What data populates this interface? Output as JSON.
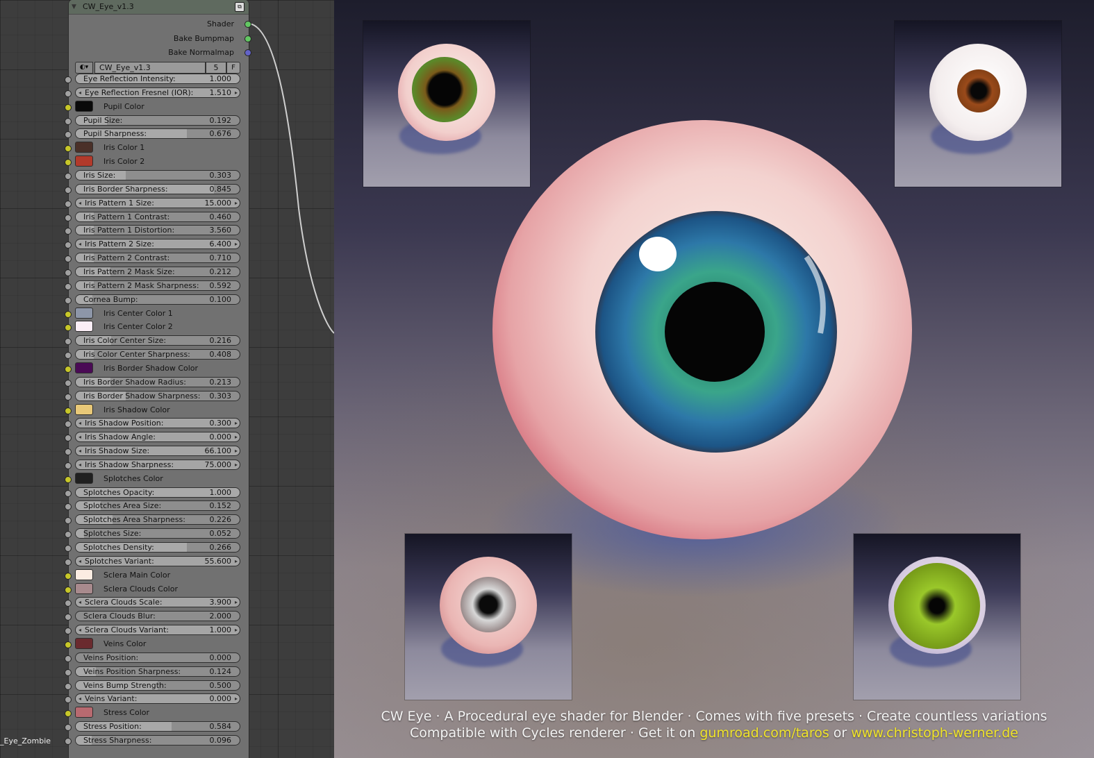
{
  "node": {
    "title": "CW_Eye_v1.3",
    "outputs": [
      "Shader",
      "Bake Bumpmap",
      "Bake Normalmap"
    ],
    "group": {
      "name": "CW_Eye_v1.3",
      "users": "5",
      "fake": "F"
    },
    "inputs": [
      {
        "kind": "slider",
        "label": "Eye Reflection Intensity:",
        "value": "1.000",
        "fill": 1.0
      },
      {
        "kind": "num",
        "label": "Eye Reflection Fresnel (IOR):",
        "value": "1.510"
      },
      {
        "kind": "color",
        "label": "Pupil Color",
        "color": "#0a0a0a"
      },
      {
        "kind": "slider",
        "label": "Pupil Size:",
        "value": "0.192",
        "fill": 0.192
      },
      {
        "kind": "slider",
        "label": "Pupil Sharpness:",
        "value": "0.676",
        "fill": 0.676
      },
      {
        "kind": "color",
        "label": "Iris Color 1",
        "color": "#4a3028"
      },
      {
        "kind": "color",
        "label": "Iris Color 2",
        "color": "#b23a2b"
      },
      {
        "kind": "slider",
        "label": "Iris Size:",
        "value": "0.303",
        "fill": 0.303
      },
      {
        "kind": "slider",
        "label": "Iris Border Sharpness:",
        "value": "0.845",
        "fill": 0.845
      },
      {
        "kind": "num",
        "label": "Iris Pattern 1 Size:",
        "value": "15.000"
      },
      {
        "kind": "slider",
        "label": "Iris Pattern 1 Contrast:",
        "value": "0.460",
        "fill": 0.11
      },
      {
        "kind": "slider",
        "label": "Iris Pattern 1 Distortion:",
        "value": "3.560",
        "fill": 0.11
      },
      {
        "kind": "num",
        "label": "Iris Pattern 2 Size:",
        "value": "6.400"
      },
      {
        "kind": "slider",
        "label": "Iris Pattern 2 Contrast:",
        "value": "0.710",
        "fill": 0.11
      },
      {
        "kind": "slider",
        "label": "Iris Pattern 2 Mask Size:",
        "value": "0.212",
        "fill": 0.212
      },
      {
        "kind": "slider",
        "label": "Iris Pattern 2 Mask Sharpness:",
        "value": "0.592",
        "fill": 0.11
      },
      {
        "kind": "slider",
        "label": "Cornea Bump:",
        "value": "0.100",
        "fill": 0.1
      },
      {
        "kind": "color",
        "label": "Iris Center Color 1",
        "color": "#8d96a8"
      },
      {
        "kind": "color",
        "label": "Iris Center Color 2",
        "color": "#fbeef6"
      },
      {
        "kind": "slider",
        "label": "Iris Color Center Size:",
        "value": "0.216",
        "fill": 0.216
      },
      {
        "kind": "slider",
        "label": "Iris Color Center Sharpness:",
        "value": "0.408",
        "fill": 0.11
      },
      {
        "kind": "color",
        "label": "Iris Border Shadow Color",
        "color": "#4a0a55"
      },
      {
        "kind": "slider",
        "label": "Iris Border Shadow Radius:",
        "value": "0.213",
        "fill": 0.213
      },
      {
        "kind": "slider",
        "label": "Iris Border Shadow Sharpness:",
        "value": "0.303",
        "fill": 0.303
      },
      {
        "kind": "color",
        "label": "Iris Shadow Color",
        "color": "#e8c878"
      },
      {
        "kind": "num",
        "label": "Iris Shadow Position:",
        "value": "0.300"
      },
      {
        "kind": "num",
        "label": "Iris Shadow Angle:",
        "value": "0.000"
      },
      {
        "kind": "num",
        "label": "Iris Shadow Size:",
        "value": "66.100"
      },
      {
        "kind": "num",
        "label": "Iris Shadow Sharpness:",
        "value": "75.000"
      },
      {
        "kind": "color",
        "label": "Splotches Color",
        "color": "#202020"
      },
      {
        "kind": "slider",
        "label": "Splotches Opacity:",
        "value": "1.000",
        "fill": 1.0
      },
      {
        "kind": "slider",
        "label": "Splotches Area Size:",
        "value": "0.152",
        "fill": 0.152
      },
      {
        "kind": "slider",
        "label": "Splotches Area Sharpness:",
        "value": "0.226",
        "fill": 0.226
      },
      {
        "kind": "slider",
        "label": "Splotches Size:",
        "value": "0.052",
        "fill": 0.052
      },
      {
        "kind": "slider",
        "label": "Splotches Density:",
        "value": "0.266",
        "fill": 0.68
      },
      {
        "kind": "num",
        "label": "Splotches Variant:",
        "value": "55.600"
      },
      {
        "kind": "color",
        "label": "Sclera Main Color",
        "color": "#fbece2"
      },
      {
        "kind": "color",
        "label": "Sclera Clouds Color",
        "color": "#a88a8d"
      },
      {
        "kind": "num",
        "label": "Sclera Clouds Scale:",
        "value": "3.900"
      },
      {
        "kind": "slider",
        "label": "Sclera Clouds Blur:",
        "value": "2.000",
        "fill": 0.0
      },
      {
        "kind": "num",
        "label": "Sclera Clouds Variant:",
        "value": "1.000"
      },
      {
        "kind": "color",
        "label": "Veins Color",
        "color": "#6a2a2e"
      },
      {
        "kind": "slider",
        "label": "Veins Position:",
        "value": "0.000",
        "fill": 0.0
      },
      {
        "kind": "slider",
        "label": "Veins Position Sharpness:",
        "value": "0.124",
        "fill": 0.124
      },
      {
        "kind": "slider",
        "label": "Veins Bump Strength:",
        "value": "0.500",
        "fill": 0.5
      },
      {
        "kind": "num",
        "label": "Veins Variant:",
        "value": "0.000"
      },
      {
        "kind": "color",
        "label": "Stress Color",
        "color": "#b86a70"
      },
      {
        "kind": "slider",
        "label": "Stress Position:",
        "value": "0.584",
        "fill": 0.584
      },
      {
        "kind": "slider",
        "label": "Stress  Sharpness:",
        "value": "0.096",
        "fill": 0.096
      }
    ]
  },
  "left_label": "_Eye_Zombie",
  "caption": {
    "line1": "CW Eye · A Procedural eye shader for Blender · Comes with five presets · Create countless variations",
    "line2_pre": "Compatible with Cycles renderer · Get it on ",
    "link1": "gumroad.com/taros",
    "line2_mid": " or ",
    "link2": "www.christoph-werner.de"
  },
  "colors": {
    "link": "#f0e42a",
    "sock_float": "#a1a1a1",
    "sock_color": "#c7c729"
  }
}
